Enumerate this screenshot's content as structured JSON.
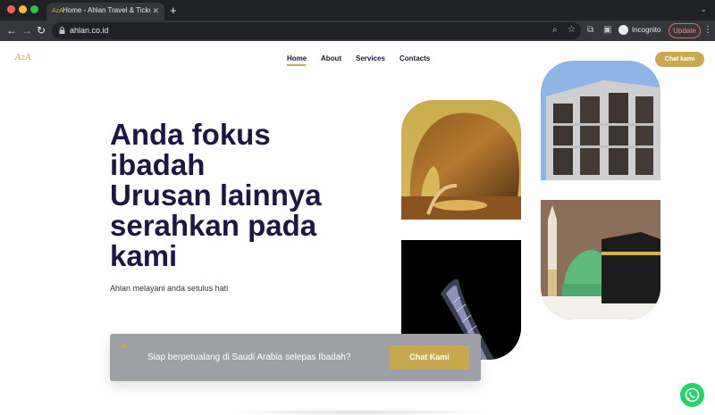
{
  "browser": {
    "tab_title": "Home - Ahlan Travel & Tickets",
    "tab_favicon": "AzA",
    "new_tab": "+",
    "close_tab": "✕",
    "url": "ahlan.co.id",
    "profile_label": "Incognito",
    "update_label": "Update"
  },
  "site": {
    "logo": "AzA",
    "nav": [
      "Home",
      "About",
      "Services",
      "Contacts"
    ],
    "nav_active": "Home",
    "chat_button": "Chat kami"
  },
  "hero": {
    "headline_lines": [
      "Anda fokus",
      "ibadah",
      "Urusan lainnya",
      "serahkan pada",
      "kami"
    ],
    "subtitle": "Ahlan melayani anda setulus hati"
  },
  "cta": {
    "text": "Siap berpetualang di Saudi Arabia selepas Ibadah?",
    "button": "Chat Kami"
  },
  "colors": {
    "accent": "#c9a94f",
    "heading": "#1d1745",
    "cta_bg": "#9ea0a8",
    "whatsapp": "#25d366"
  },
  "icons": [
    "back-icon",
    "forward-icon",
    "reload-icon",
    "lock-icon",
    "search-icon",
    "star-icon",
    "extensions-icon",
    "sidepanel-icon",
    "incognito-icon",
    "kebab-icon",
    "whatsapp-icon"
  ]
}
